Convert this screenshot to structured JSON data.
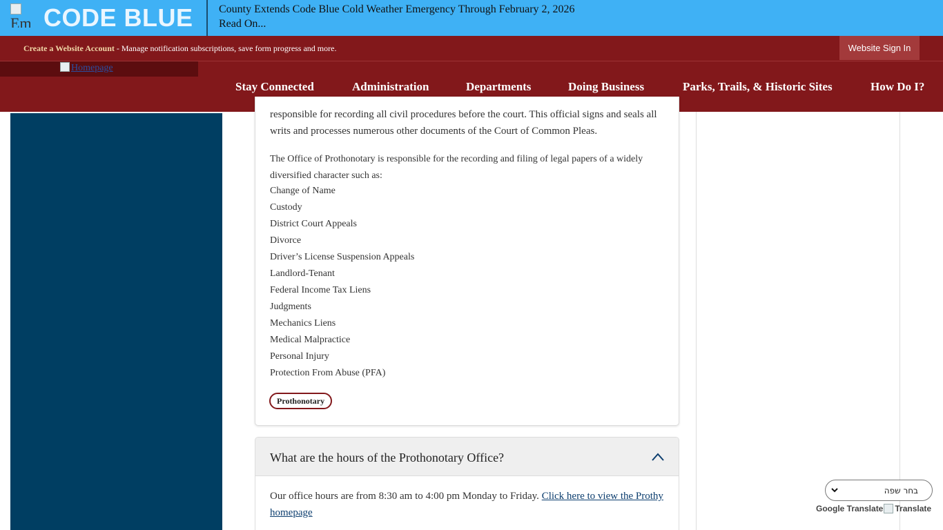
{
  "alert": {
    "image_alt": "Em",
    "title": "CODE BLUE",
    "headline": "County Extends Code Blue Cold Weather Emergency Through February 2, 2026",
    "read_on": "Read On..."
  },
  "account_bar": {
    "create_link": "Create a Website Account",
    "description": " - Manage notification subscriptions, save form progress and more.",
    "sign_in": "Website Sign In"
  },
  "logo": {
    "alt": "Homepage"
  },
  "nav": {
    "items": [
      {
        "label": "Stay Connected"
      },
      {
        "label": "Administration"
      },
      {
        "label": "Departments"
      },
      {
        "label": "Doing Business"
      },
      {
        "label": "Parks, Trails, & Historic Sites"
      },
      {
        "label": "How Do I?"
      }
    ]
  },
  "content": {
    "intro": "responsible for recording all civil procedures before the court. This official signs and seals all writs and processes numerous other documents of the Court of Common Pleas.",
    "paragraph": "The Office of Prothonotary is responsible for the recording and filing of legal papers of a widely diversified character such as:",
    "list": [
      "Change of Name",
      "Custody",
      "District Court Appeals",
      "Divorce",
      "Driver’s License Suspension Appeals",
      "Landlord-Tenant",
      "Federal Income Tax Liens",
      "Judgments",
      "Mechanics Liens",
      "Medical Malpractice",
      "Personal Injury",
      "Protection From Abuse (PFA)"
    ],
    "tag": "Prothonotary"
  },
  "faq": {
    "question": "What are the hours of the Prothonotary Office?",
    "answer_text": "Our office hours are from 8:30 am to 4:00 pm Monday to Friday. ",
    "answer_link": "Click here to view the Prothy homepage"
  },
  "translate": {
    "select_label": "בחר שפה",
    "powered_by": "Google Translate",
    "translate_label": "Translate"
  },
  "colors": {
    "alert_bg": "#3fb1f5",
    "brand_red": "#82181b",
    "sidebar_blue": "#003e62",
    "link_gold": "#f1d7a7"
  }
}
